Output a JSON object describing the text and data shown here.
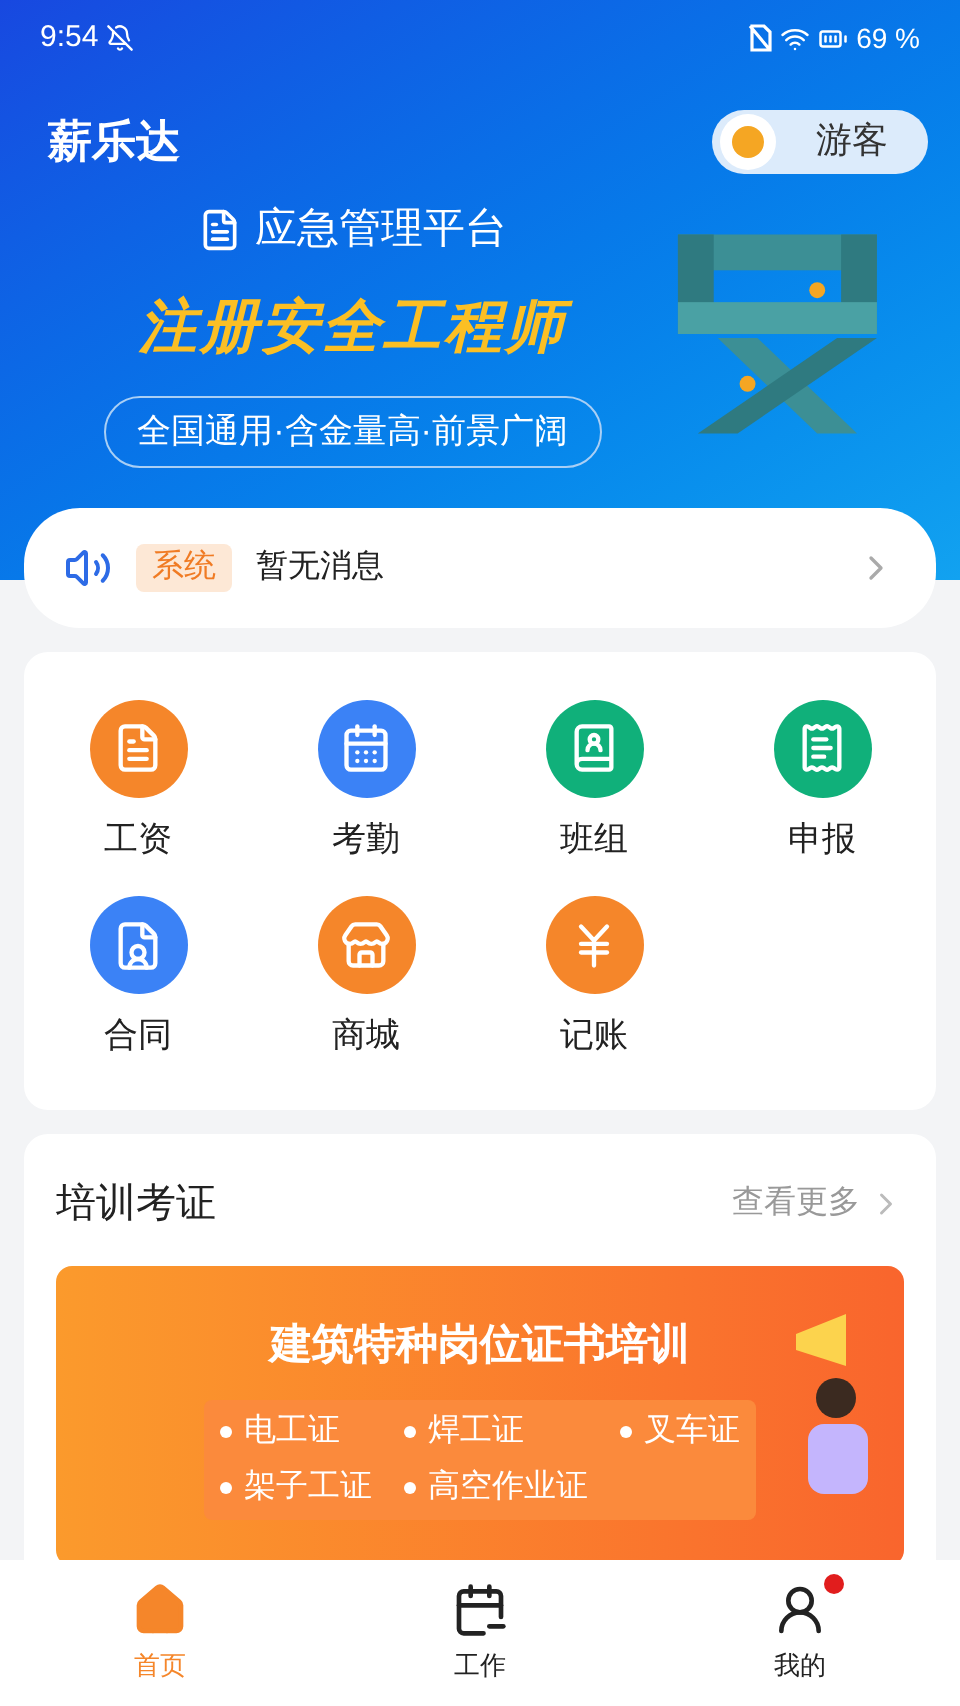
{
  "status_bar": {
    "time": "9:54",
    "battery": "69 %"
  },
  "header": {
    "brand": "薪乐达",
    "user": {
      "name": "游客"
    }
  },
  "banner": {
    "platform": "应急管理平台",
    "headline": "注册安全工程师",
    "tagline": "全国通用·含金量高·前景广阔"
  },
  "notice": {
    "tag": "系统",
    "message": "暂无消息"
  },
  "apps": [
    {
      "label": "工资",
      "kind": "sheet",
      "color": "#f5862a"
    },
    {
      "label": "考勤",
      "kind": "calendar",
      "color": "#3b82f6"
    },
    {
      "label": "班组",
      "kind": "contacts",
      "color": "#10b07a"
    },
    {
      "label": "申报",
      "kind": "receipt",
      "color": "#10b07a"
    },
    {
      "label": "合同",
      "kind": "contract",
      "color": "#3b82f6"
    },
    {
      "label": "商城",
      "kind": "store",
      "color": "#f5862a"
    },
    {
      "label": "记账",
      "kind": "ledger",
      "color": "#f5862a"
    }
  ],
  "training": {
    "title": "培训考证",
    "more": "查看更多",
    "promo": {
      "title": "建筑特种岗位证书培训",
      "items": [
        "电工证",
        "焊工证",
        "叉车证",
        "架子工证",
        "高空作业证"
      ]
    }
  },
  "tab_bar": [
    {
      "label": "首页",
      "kind": "home",
      "selected": true,
      "dot": false
    },
    {
      "label": "工作",
      "kind": "work",
      "selected": false,
      "dot": false
    },
    {
      "label": "我的",
      "kind": "me",
      "selected": false,
      "dot": true
    }
  ]
}
